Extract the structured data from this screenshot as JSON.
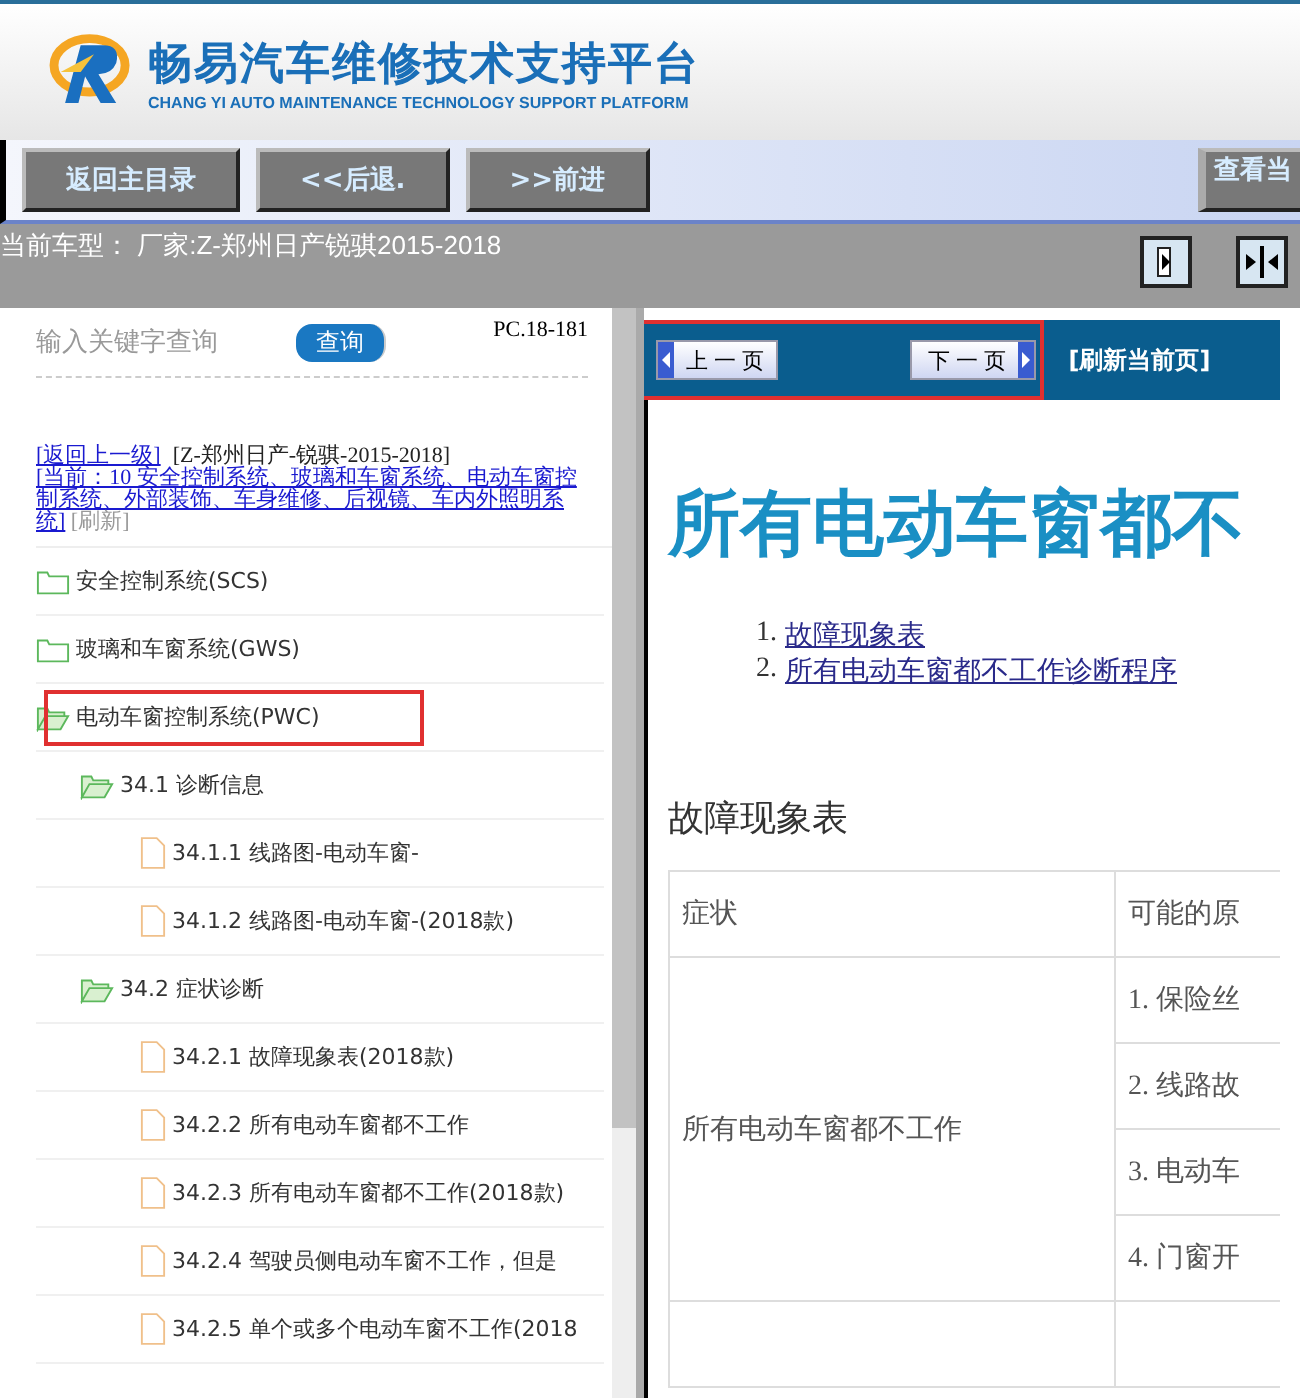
{
  "header": {
    "title": "畅易汽车维修技术支持平台",
    "subtitle": "CHANG YI AUTO MAINTENANCE TECHNOLOGY SUPPORT PLATFORM"
  },
  "toolbar": {
    "buttons": [
      "返回主目录",
      "<<后退.",
      ">>前进"
    ],
    "right_button": "查看当"
  },
  "vehicle_bar": {
    "text": "当前车型：  厂家:Z-郑州日产锐骐2015-2018"
  },
  "sidebar": {
    "search": {
      "placeholder": "输入关键字查询",
      "button": "查询"
    },
    "code": "PC.18-181",
    "breadcrumb": {
      "back": "[返回上一级]",
      "model": "[Z-郑州日产-锐骐-2015-2018]",
      "current": "[当前：10 安全控制系统、玻璃和车窗系统、电动车窗控制系统、外部装饰、车身维修、后视镜、车内外照明系统]",
      "refresh": "[刷新]"
    },
    "tree": [
      {
        "kind": "folder",
        "label": "安全控制系统(SCS)",
        "expanded": false,
        "highlighted": false
      },
      {
        "kind": "folder",
        "label": "玻璃和车窗系统(GWS)",
        "expanded": false,
        "highlighted": false
      },
      {
        "kind": "folder",
        "label": "电动车窗控制系统(PWC)",
        "expanded": true,
        "highlighted": true,
        "children": [
          {
            "kind": "folder",
            "label": "34.1 诊断信息",
            "expanded": true,
            "children": [
              {
                "kind": "file",
                "label": "34.1.1 线路图-电动车窗-"
              },
              {
                "kind": "file",
                "label": "34.1.2 线路图-电动车窗-(2018款)"
              }
            ]
          },
          {
            "kind": "folder",
            "label": "34.2 症状诊断",
            "expanded": true,
            "children": [
              {
                "kind": "file",
                "label": "34.2.1 故障现象表(2018款)"
              },
              {
                "kind": "file",
                "label": "34.2.2 所有电动车窗都不工作"
              },
              {
                "kind": "file",
                "label": "34.2.3 所有电动车窗都不工作(2018款)"
              },
              {
                "kind": "file",
                "label": "34.2.4 驾驶员侧电动车窗不工作，但是"
              },
              {
                "kind": "file",
                "label": "34.2.5 单个或多个电动车窗不工作(2018"
              }
            ]
          }
        ]
      }
    ]
  },
  "pager": {
    "prev": "上 一 页",
    "next": "下 一 页",
    "refresh": "[刷新当前页]",
    "highlighted": true
  },
  "document": {
    "title": "所有电动车窗都不",
    "toc": [
      {
        "number": "1.",
        "link": "故障现象表"
      },
      {
        "number": "2.",
        "link": "所有电动车窗都不工作诊断程序"
      }
    ],
    "section": "故障现象表",
    "table": {
      "columns": [
        "症状",
        "可能的原"
      ],
      "symptom": "所有电动车窗都不工作",
      "causes": [
        "1. 保险丝",
        "2. 线路故",
        "3. 电动车",
        "4. 门窗开"
      ]
    }
  }
}
